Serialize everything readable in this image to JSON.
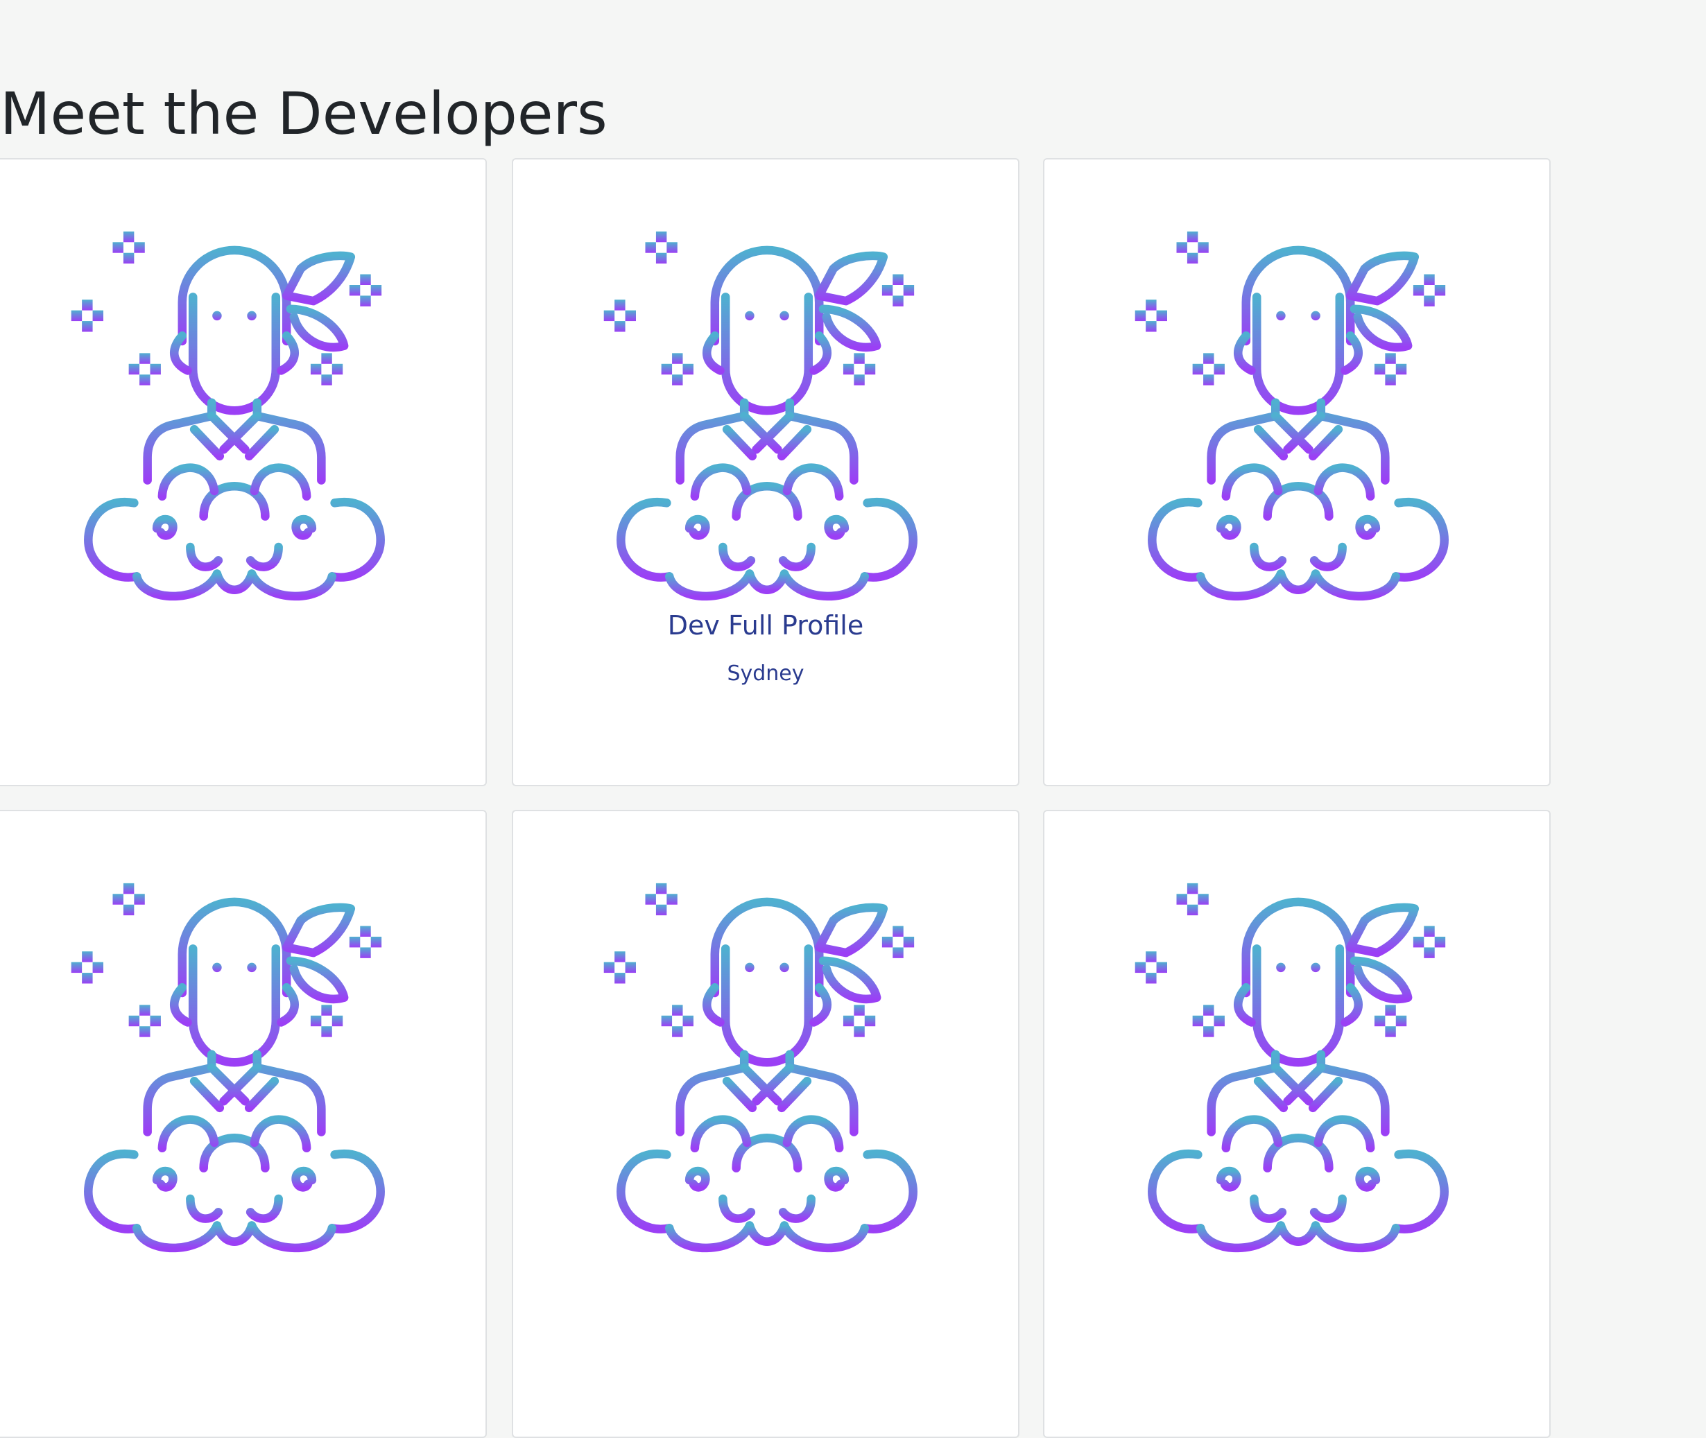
{
  "page": {
    "title": "Meet the Developers"
  },
  "colors": {
    "background": "#f5f6f5",
    "card_bg": "#ffffff",
    "card_border": "#dfe1e3",
    "title_text": "#212529",
    "profile_text": "#2a3b8f",
    "icon_gradient_top": "#4fb0d0",
    "icon_gradient_bottom": "#9b3ff5"
  },
  "developers": [
    {
      "name": "",
      "location": "",
      "icon": "ninja-avatar-icon"
    },
    {
      "name": "Dev Full Profile",
      "location": "Sydney",
      "icon": "ninja-avatar-icon"
    },
    {
      "name": "",
      "location": "",
      "icon": "ninja-avatar-icon"
    },
    {
      "name": "",
      "location": "",
      "icon": "ninja-avatar-icon"
    },
    {
      "name": "",
      "location": "",
      "icon": "ninja-avatar-icon"
    },
    {
      "name": "",
      "location": "",
      "icon": "ninja-avatar-icon"
    }
  ]
}
